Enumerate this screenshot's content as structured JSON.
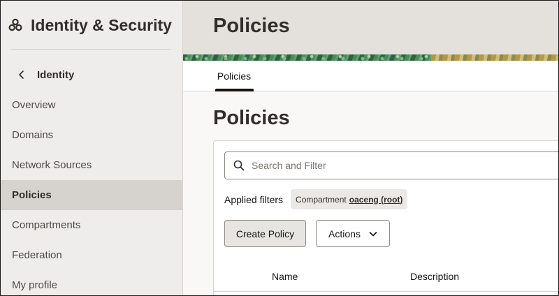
{
  "sidebar": {
    "title": "Identity & Security",
    "logo_icon": "oci-logo-icon",
    "back_label": "Identity",
    "items": [
      {
        "label": "Overview",
        "active": false
      },
      {
        "label": "Domains",
        "active": false
      },
      {
        "label": "Network Sources",
        "active": false
      },
      {
        "label": "Policies",
        "active": true
      },
      {
        "label": "Compartments",
        "active": false
      },
      {
        "label": "Federation",
        "active": false
      },
      {
        "label": "My profile",
        "active": false
      }
    ]
  },
  "header": {
    "title": "Policies"
  },
  "tabs": [
    {
      "label": "Policies",
      "active": true
    }
  ],
  "content": {
    "title": "Policies",
    "search": {
      "placeholder": "Search and Filter",
      "value": ""
    },
    "filters": {
      "label": "Applied filters",
      "chip": {
        "key": "Compartment",
        "value": "oaceng (root)"
      }
    },
    "buttons": {
      "create": "Create Policy",
      "actions": "Actions"
    },
    "table": {
      "columns": [
        "Name",
        "Description"
      ]
    }
  },
  "colors": {
    "sidebar_bg": "#efedeb",
    "active_item_bg": "#d6d3cf",
    "header_bg": "#e4e1dd",
    "text": "#312d2a"
  }
}
